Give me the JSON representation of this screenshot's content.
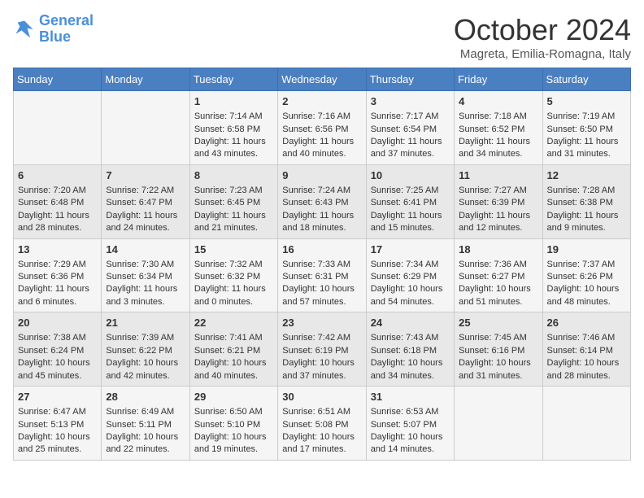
{
  "header": {
    "logo_line1": "General",
    "logo_line2": "Blue",
    "month_title": "October 2024",
    "location": "Magreta, Emilia-Romagna, Italy"
  },
  "days_of_week": [
    "Sunday",
    "Monday",
    "Tuesday",
    "Wednesday",
    "Thursday",
    "Friday",
    "Saturday"
  ],
  "weeks": [
    [
      {
        "day": "",
        "sunrise": "",
        "sunset": "",
        "daylight": ""
      },
      {
        "day": "",
        "sunrise": "",
        "sunset": "",
        "daylight": ""
      },
      {
        "day": "1",
        "sunrise": "Sunrise: 7:14 AM",
        "sunset": "Sunset: 6:58 PM",
        "daylight": "Daylight: 11 hours and 43 minutes."
      },
      {
        "day": "2",
        "sunrise": "Sunrise: 7:16 AM",
        "sunset": "Sunset: 6:56 PM",
        "daylight": "Daylight: 11 hours and 40 minutes."
      },
      {
        "day": "3",
        "sunrise": "Sunrise: 7:17 AM",
        "sunset": "Sunset: 6:54 PM",
        "daylight": "Daylight: 11 hours and 37 minutes."
      },
      {
        "day": "4",
        "sunrise": "Sunrise: 7:18 AM",
        "sunset": "Sunset: 6:52 PM",
        "daylight": "Daylight: 11 hours and 34 minutes."
      },
      {
        "day": "5",
        "sunrise": "Sunrise: 7:19 AM",
        "sunset": "Sunset: 6:50 PM",
        "daylight": "Daylight: 11 hours and 31 minutes."
      }
    ],
    [
      {
        "day": "6",
        "sunrise": "Sunrise: 7:20 AM",
        "sunset": "Sunset: 6:48 PM",
        "daylight": "Daylight: 11 hours and 28 minutes."
      },
      {
        "day": "7",
        "sunrise": "Sunrise: 7:22 AM",
        "sunset": "Sunset: 6:47 PM",
        "daylight": "Daylight: 11 hours and 24 minutes."
      },
      {
        "day": "8",
        "sunrise": "Sunrise: 7:23 AM",
        "sunset": "Sunset: 6:45 PM",
        "daylight": "Daylight: 11 hours and 21 minutes."
      },
      {
        "day": "9",
        "sunrise": "Sunrise: 7:24 AM",
        "sunset": "Sunset: 6:43 PM",
        "daylight": "Daylight: 11 hours and 18 minutes."
      },
      {
        "day": "10",
        "sunrise": "Sunrise: 7:25 AM",
        "sunset": "Sunset: 6:41 PM",
        "daylight": "Daylight: 11 hours and 15 minutes."
      },
      {
        "day": "11",
        "sunrise": "Sunrise: 7:27 AM",
        "sunset": "Sunset: 6:39 PM",
        "daylight": "Daylight: 11 hours and 12 minutes."
      },
      {
        "day": "12",
        "sunrise": "Sunrise: 7:28 AM",
        "sunset": "Sunset: 6:38 PM",
        "daylight": "Daylight: 11 hours and 9 minutes."
      }
    ],
    [
      {
        "day": "13",
        "sunrise": "Sunrise: 7:29 AM",
        "sunset": "Sunset: 6:36 PM",
        "daylight": "Daylight: 11 hours and 6 minutes."
      },
      {
        "day": "14",
        "sunrise": "Sunrise: 7:30 AM",
        "sunset": "Sunset: 6:34 PM",
        "daylight": "Daylight: 11 hours and 3 minutes."
      },
      {
        "day": "15",
        "sunrise": "Sunrise: 7:32 AM",
        "sunset": "Sunset: 6:32 PM",
        "daylight": "Daylight: 11 hours and 0 minutes."
      },
      {
        "day": "16",
        "sunrise": "Sunrise: 7:33 AM",
        "sunset": "Sunset: 6:31 PM",
        "daylight": "Daylight: 10 hours and 57 minutes."
      },
      {
        "day": "17",
        "sunrise": "Sunrise: 7:34 AM",
        "sunset": "Sunset: 6:29 PM",
        "daylight": "Daylight: 10 hours and 54 minutes."
      },
      {
        "day": "18",
        "sunrise": "Sunrise: 7:36 AM",
        "sunset": "Sunset: 6:27 PM",
        "daylight": "Daylight: 10 hours and 51 minutes."
      },
      {
        "day": "19",
        "sunrise": "Sunrise: 7:37 AM",
        "sunset": "Sunset: 6:26 PM",
        "daylight": "Daylight: 10 hours and 48 minutes."
      }
    ],
    [
      {
        "day": "20",
        "sunrise": "Sunrise: 7:38 AM",
        "sunset": "Sunset: 6:24 PM",
        "daylight": "Daylight: 10 hours and 45 minutes."
      },
      {
        "day": "21",
        "sunrise": "Sunrise: 7:39 AM",
        "sunset": "Sunset: 6:22 PM",
        "daylight": "Daylight: 10 hours and 42 minutes."
      },
      {
        "day": "22",
        "sunrise": "Sunrise: 7:41 AM",
        "sunset": "Sunset: 6:21 PM",
        "daylight": "Daylight: 10 hours and 40 minutes."
      },
      {
        "day": "23",
        "sunrise": "Sunrise: 7:42 AM",
        "sunset": "Sunset: 6:19 PM",
        "daylight": "Daylight: 10 hours and 37 minutes."
      },
      {
        "day": "24",
        "sunrise": "Sunrise: 7:43 AM",
        "sunset": "Sunset: 6:18 PM",
        "daylight": "Daylight: 10 hours and 34 minutes."
      },
      {
        "day": "25",
        "sunrise": "Sunrise: 7:45 AM",
        "sunset": "Sunset: 6:16 PM",
        "daylight": "Daylight: 10 hours and 31 minutes."
      },
      {
        "day": "26",
        "sunrise": "Sunrise: 7:46 AM",
        "sunset": "Sunset: 6:14 PM",
        "daylight": "Daylight: 10 hours and 28 minutes."
      }
    ],
    [
      {
        "day": "27",
        "sunrise": "Sunrise: 6:47 AM",
        "sunset": "Sunset: 5:13 PM",
        "daylight": "Daylight: 10 hours and 25 minutes."
      },
      {
        "day": "28",
        "sunrise": "Sunrise: 6:49 AM",
        "sunset": "Sunset: 5:11 PM",
        "daylight": "Daylight: 10 hours and 22 minutes."
      },
      {
        "day": "29",
        "sunrise": "Sunrise: 6:50 AM",
        "sunset": "Sunset: 5:10 PM",
        "daylight": "Daylight: 10 hours and 19 minutes."
      },
      {
        "day": "30",
        "sunrise": "Sunrise: 6:51 AM",
        "sunset": "Sunset: 5:08 PM",
        "daylight": "Daylight: 10 hours and 17 minutes."
      },
      {
        "day": "31",
        "sunrise": "Sunrise: 6:53 AM",
        "sunset": "Sunset: 5:07 PM",
        "daylight": "Daylight: 10 hours and 14 minutes."
      },
      {
        "day": "",
        "sunrise": "",
        "sunset": "",
        "daylight": ""
      },
      {
        "day": "",
        "sunrise": "",
        "sunset": "",
        "daylight": ""
      }
    ]
  ]
}
